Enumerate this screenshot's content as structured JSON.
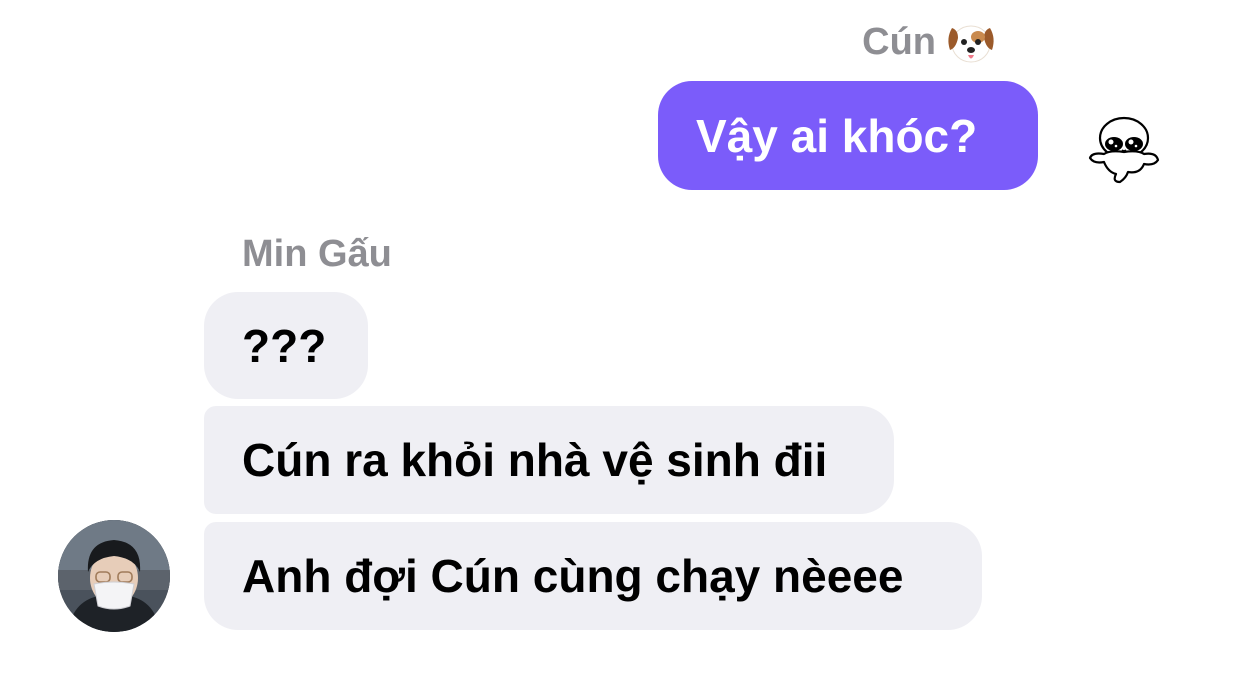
{
  "messages": {
    "outgoing": {
      "sender": "Cún",
      "sender_emoji": "dog-face-icon",
      "text": "Vậy ai khóc?",
      "bubble_color": "#7b5cfa"
    },
    "incoming": {
      "sender": "Min Gấu",
      "bubble_color": "#efeff4",
      "items": [
        {
          "text": "???"
        },
        {
          "text": "Cún ra khỏi nhà vệ sinh đii"
        },
        {
          "text": "Anh đợi Cún cùng chạy nèeee"
        }
      ]
    }
  },
  "read_receipt": "cartoon-sticker-icon",
  "avatar": "user-avatar"
}
